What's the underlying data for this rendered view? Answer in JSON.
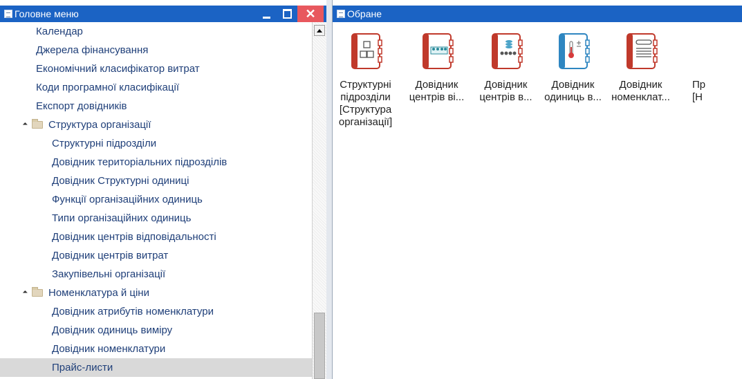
{
  "left_panel": {
    "title": "Головне меню",
    "window_buttons": [
      "_",
      "□",
      "✕"
    ],
    "tree": [
      {
        "label": "Календар",
        "level": 1
      },
      {
        "label": "Джерела фінансування",
        "level": 1
      },
      {
        "label": "Економічний класифікатор витрат",
        "level": 1
      },
      {
        "label": "Коди програмної класифікації",
        "level": 1
      },
      {
        "label": "Експорт довідників",
        "level": 1
      },
      {
        "label": "Структура організації",
        "level": 0,
        "expanded": true
      },
      {
        "label": "Структурні підрозділи",
        "level": 2
      },
      {
        "label": "Довідник територіальних підрозділів",
        "level": 2
      },
      {
        "label": "Довідник Структурні одиниці",
        "level": 2
      },
      {
        "label": "Функції організаційних одиниць",
        "level": 2
      },
      {
        "label": "Типи організаційних одиниць",
        "level": 2
      },
      {
        "label": "Довідник центрів відповідальності",
        "level": 2
      },
      {
        "label": "Довідник центрів витрат",
        "level": 2
      },
      {
        "label": "Закупівельні організації",
        "level": 2
      },
      {
        "label": "Номенклатура й ціни",
        "level": 0,
        "expanded": true
      },
      {
        "label": "Довідник атрибутів номенклатури",
        "level": 2
      },
      {
        "label": "Довідник одиниць виміру",
        "level": 2
      },
      {
        "label": "Довідник номенклатури",
        "level": 2
      },
      {
        "label": "Прайс-листи",
        "level": 2,
        "selected": true
      }
    ]
  },
  "right_panel": {
    "title": "Обране",
    "favorites": [
      {
        "label": "Структурні\nпідрозділи\n[Структура\nорганізації]",
        "icon": "org-structure-icon",
        "color": "#c0392b"
      },
      {
        "label": "Довідник\nцентрів ві...",
        "icon": "people-group-icon",
        "color": "#c0392b"
      },
      {
        "label": "Довідник\nцентрів в...",
        "icon": "people-coins-icon",
        "color": "#c0392b"
      },
      {
        "label": "Довідник\nодиниць в...",
        "icon": "thermometer-icon",
        "color": "#2e86c1"
      },
      {
        "label": "Довідник\nноменклат...",
        "icon": "document-list-icon",
        "color": "#c0392b"
      },
      {
        "label": "Пр\n[Н",
        "icon": "",
        "color": "#c0392b"
      }
    ]
  },
  "colors": {
    "titlebar": "#1b63c4",
    "tree_text": "#1f3f79",
    "selected_row": "#d9d9d9",
    "close_button": "#e8585e"
  }
}
